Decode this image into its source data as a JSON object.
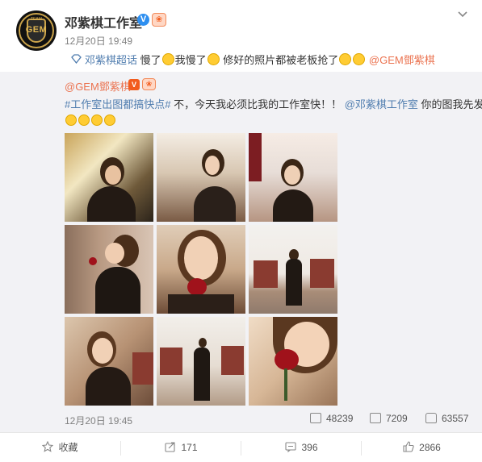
{
  "post": {
    "author": "邓紫棋工作室",
    "avatar_text": "GEM",
    "avatar_small_text": "TEAM",
    "verified_badge": "V",
    "time": "12月20日 19:49",
    "text_parts": {
      "topic": "邓紫棋超话",
      "p1": "慢了",
      "p2": "我慢了",
      "p3": " 修好的照片都被老板抢了",
      "mention": "@GEM鄧紫棋"
    }
  },
  "repost": {
    "author": "@GEM鄧紫棋",
    "text_parts": {
      "hashtag": "#工作室出图都搞快点#",
      "body": " 不，今天我必须比我的工作室快！！",
      "mention": "@邓紫棋工作室",
      "tail": " 你的图我先发咯"
    },
    "time": "12月20日 19:45",
    "stats": {
      "reposts": "48239",
      "comments": "7209",
      "likes": "63557"
    }
  },
  "actions": {
    "favorite": "收藏",
    "repost": "171",
    "comment": "396",
    "like": "2866"
  },
  "colors": {
    "link": "#eb7350",
    "topic": "#507daf",
    "repost_bg": "#f2f2f5"
  }
}
